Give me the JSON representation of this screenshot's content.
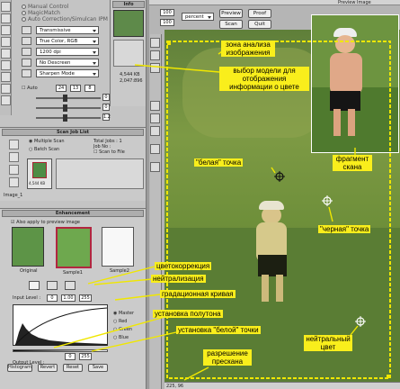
{
  "left_panel": {
    "info_title": "Info",
    "options": [
      "Manual Control",
      "MagicMatch",
      "Auto Correction/Simulcan IPM"
    ],
    "dropdowns": [
      "Transmissive",
      "True Color, RGB",
      "1200 dpi",
      "No Descreen",
      "Sharpen Mode"
    ],
    "auto_label": "Auto",
    "auto_values": [
      "24",
      "13",
      "8"
    ],
    "adjust_values": [
      "0",
      "0",
      "1.2"
    ],
    "info_readouts": [
      "4,544 KB",
      "2,047:896"
    ],
    "scan_job_title": "Scan Job List",
    "multiple_scan": "Multiple Scan",
    "batch_scan": "Batch Scan",
    "total_jobs": "Total Jobs : 1",
    "job_no": "Job No :",
    "scan_to_file": "Scan to File",
    "thumb_size": "4,544 KB",
    "image_name": "Image_1",
    "enhancement_title": "Enhancement",
    "also_apply": "Also apply to preview image",
    "thumb_labels": [
      "Original",
      "Sample1",
      "Sample2"
    ],
    "input_level": "Input Level :",
    "input_values": [
      "0",
      "1.00",
      "255"
    ],
    "channels": [
      "Master",
      "Red",
      "Green",
      "Blue"
    ],
    "output_level": "Output Level :",
    "output_values": [
      "0",
      "255"
    ],
    "bottom_buttons": [
      "Histogram",
      "Revert",
      "Reset",
      "Save"
    ]
  },
  "right_panel": {
    "title": "Preview Image",
    "zoom": [
      "100",
      "100"
    ],
    "units": "percent",
    "buttons": [
      "Preview",
      "Proof",
      "Scan",
      "Quit"
    ],
    "status": "225, 96"
  },
  "callouts": {
    "scan_area": "зона анализа изображения",
    "color_model": "выбор модели для отображения информации о цвете",
    "fragment": "фрагмент скана",
    "white_point": "\"белая\" точка",
    "black_point": "\"черная\" точка",
    "color_correction": "цветокоррекция",
    "neutralization": "нейтрализация",
    "gradation_curve": "градационная кривая",
    "halftone_setup": "установка полутона",
    "white_point_setup": "установка \"белой\" точки",
    "neutral_color": "нейтральный цвет",
    "prescan_resolution": "разрешение прескана"
  },
  "colors": {
    "callout_bg": "#f9ee1c",
    "selection": "#f0e700",
    "panel_bg": "#c4c4c4"
  }
}
